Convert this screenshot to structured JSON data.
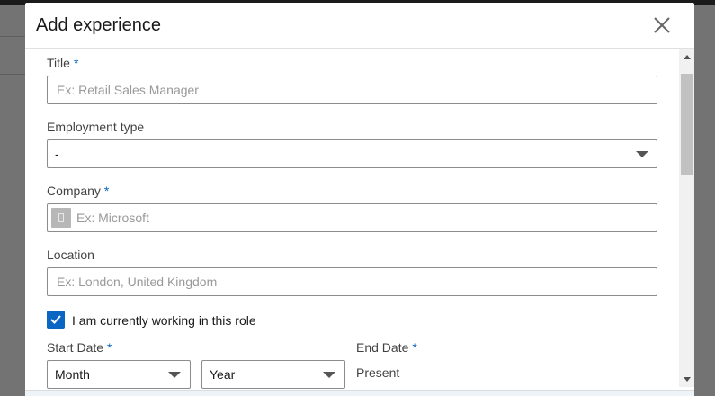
{
  "modal": {
    "title": "Add experience",
    "close_icon": "close-icon"
  },
  "form": {
    "title": {
      "label": "Title",
      "required_mark": "*",
      "placeholder": "Ex: Retail Sales Manager"
    },
    "employment_type": {
      "label": "Employment type",
      "selected": "-"
    },
    "company": {
      "label": "Company",
      "required_mark": "*",
      "placeholder": "Ex: Microsoft",
      "logo_icon": "building-icon"
    },
    "location": {
      "label": "Location",
      "placeholder": "Ex: London, United Kingdom"
    },
    "currently_working": {
      "label": "I am currently working in this role",
      "checked": true
    },
    "start_date": {
      "label": "Start Date",
      "required_mark": "*",
      "month_selected": "Month",
      "year_selected": "Year"
    },
    "end_date": {
      "label": "End Date",
      "required_mark": "*",
      "value": "Present"
    }
  },
  "colors": {
    "accent": "#0a66c2",
    "input_border": "#8c8c8c",
    "backdrop": "#6b6b6b"
  }
}
